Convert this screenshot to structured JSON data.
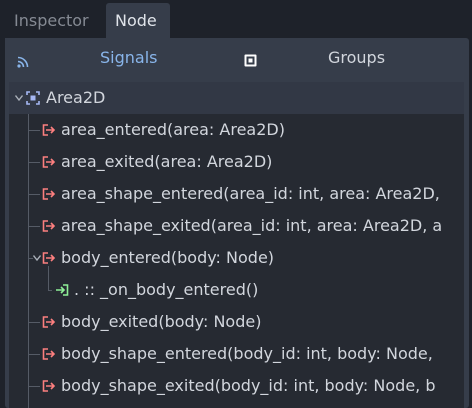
{
  "tabs": {
    "inspector": "Inspector",
    "node": "Node"
  },
  "subtabs": {
    "signals": "Signals",
    "groups": "Groups"
  },
  "tree": {
    "root": "Area2D",
    "signals": [
      "area_entered(area: Area2D)",
      "area_exited(area: Area2D)",
      "area_shape_entered(area_id: int, area: Area2D,",
      "area_shape_exited(area_id: int, area: Area2D, a",
      "body_entered(body: Node)",
      "body_exited(body: Node)",
      "body_shape_entered(body_id: int, body: Node,",
      "body_shape_exited(body_id: int, body: Node, b"
    ],
    "connection": ". :: _on_body_entered()"
  },
  "colors": {
    "signal_icon": "#fc7f7f",
    "connection_icon": "#8eef97",
    "accent": "#89b5ea"
  }
}
